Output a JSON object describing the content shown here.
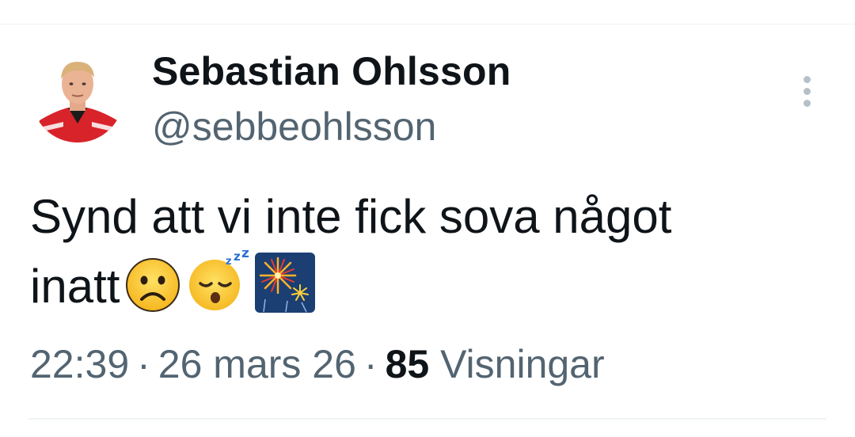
{
  "author": {
    "display_name": "Sebastian Ohlsson",
    "handle": "@sebbeohlsson"
  },
  "tweet": {
    "text": "Synd att vi inte fick sova något",
    "text_line2": "inatt",
    "emojis": [
      "frowning-face-emoji",
      "sleeping-face-emoji",
      "fireworks-emoji"
    ]
  },
  "meta": {
    "time": "22:39",
    "separator": "·",
    "date": "26 mars 26",
    "views_count": "85",
    "views_label": "Visningar"
  },
  "icons": {
    "more": "more-vertical-icon"
  },
  "colors": {
    "text_primary": "#0f1419",
    "text_secondary": "#536471",
    "divider": "#eff3f4"
  }
}
